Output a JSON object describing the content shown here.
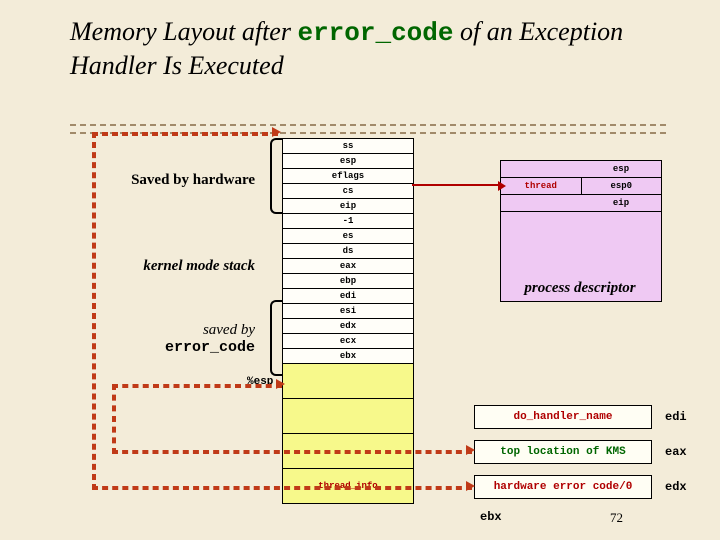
{
  "title": {
    "pre": "Memory Layout after ",
    "code": "error_code",
    "mid": " of an Exception Handler Is Executed"
  },
  "labels": {
    "saved_hw": "Saved by hardware",
    "kms": "kernel mode stack",
    "saved_by": "saved by",
    "errc": "error_code",
    "esp_ptr": "%esp",
    "pd": "process descriptor"
  },
  "stack": {
    "rows": [
      "ss",
      "esp",
      "eflags",
      "cs",
      "eip",
      "-1",
      "es",
      "ds",
      "eax",
      "ebp",
      "edi",
      "esi",
      "edx",
      "ecx",
      "ebx"
    ],
    "thread_info": "thread_info"
  },
  "pd_table": {
    "thread": "thread",
    "r1": "esp",
    "r2": "esp0",
    "r3": "eip"
  },
  "boxes": {
    "b1": "do_handler_name",
    "b2": "top location of KMS",
    "b3": "hardware error code/0"
  },
  "regs": {
    "edi": "edi",
    "eax": "eax",
    "edx": "edx",
    "ebx": "ebx"
  },
  "page": {
    "label": "ebx",
    "num": "72"
  }
}
